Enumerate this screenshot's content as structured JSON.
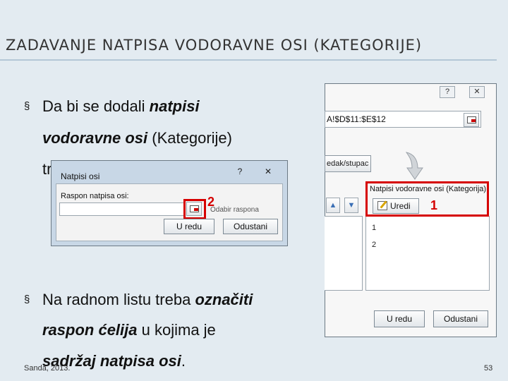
{
  "slide": {
    "title": "ZADAVANJE NATPISA VODORAVNE OSI (KATEGORIJE)",
    "bullet_marker": "§",
    "bullet1": {
      "line1_pre": "Da bi se dodali ",
      "line1_bold": "natpisi",
      "line2_bold": "vodoravne osi",
      "line2_post": " (Kategorije)",
      "line3": "treba kliknuti"
    },
    "bullet2": {
      "line1_pre": "Na radnom listu treba ",
      "line1_bold": "označiti",
      "line2_bold": "raspon ćelija",
      "line2_post": " u kojima je",
      "line3_bold": "sadržaj natpisa osi",
      "line3_post": "."
    },
    "footer": "Sanda, 2013.",
    "page_number": "53"
  },
  "big_dialog": {
    "help_icon": "?",
    "close_icon": "✕",
    "range_value": "A!$D$11:$E$12",
    "redak_button": "edak/stupac",
    "natpisi_label": "Natpisi vodoravne osi (Kategorija)",
    "uredi_button": "Uredi",
    "list_items": [
      "1",
      "2"
    ],
    "ok_button": "U redu",
    "cancel_button": "Odustani",
    "marker": "1"
  },
  "small_dialog": {
    "title": "Natpisi osi",
    "help_icon": "?",
    "close_icon": "✕",
    "raspon_label": "Raspon natpisa osi:",
    "raspon_value": "",
    "odabir_label": "Odabir raspona",
    "ok_button": "U redu",
    "cancel_button": "Odustani",
    "marker": "2"
  },
  "colors": {
    "background": "#e3ebf1",
    "highlight": "#d60000",
    "title_rule": "#b4c7d6"
  }
}
